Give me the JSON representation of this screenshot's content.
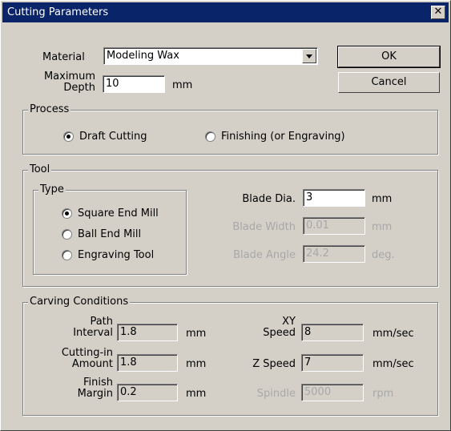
{
  "window": {
    "title": "Cutting Parameters",
    "close_icon": "close-x"
  },
  "material": {
    "label": "Material",
    "value": "Modeling Wax"
  },
  "max_depth": {
    "label_line1": "Maximum",
    "label_line2": "Depth",
    "value": "10",
    "unit": "mm"
  },
  "buttons": {
    "ok": "OK",
    "cancel": "Cancel"
  },
  "process": {
    "legend": "Process",
    "options": [
      {
        "label": "Draft Cutting",
        "selected": true
      },
      {
        "label": "Finishing (or Engraving)",
        "selected": false
      }
    ]
  },
  "tool": {
    "legend": "Tool",
    "type_legend": "Type",
    "types": [
      {
        "label": "Square End Mill",
        "selected": true
      },
      {
        "label": "Ball End Mill",
        "selected": false
      },
      {
        "label": "Engraving Tool",
        "selected": false
      }
    ],
    "blade_dia": {
      "label": "Blade Dia.",
      "value": "3",
      "unit": "mm"
    },
    "blade_width": {
      "label": "Blade Width",
      "value": "0.01",
      "unit": "mm"
    },
    "blade_angle": {
      "label": "Blade Angle",
      "value": "24.2",
      "unit": "deg."
    }
  },
  "carving": {
    "legend": "Carving Conditions",
    "path_interval": {
      "label_line1": "Path",
      "label_line2": "Interval",
      "value": "1.8",
      "unit": "mm"
    },
    "cutting_in": {
      "label_line1": "Cutting-in",
      "label_line2": "Amount",
      "value": "1.8",
      "unit": "mm"
    },
    "finish_margin": {
      "label_line1": "Finish",
      "label_line2": "Margin",
      "value": "0.2",
      "unit": "mm"
    },
    "xy_speed": {
      "label_line1": "XY",
      "label_line2": "Speed",
      "value": "8",
      "unit": "mm/sec"
    },
    "z_speed": {
      "label": "Z Speed",
      "value": "7",
      "unit": "mm/sec"
    },
    "spindle": {
      "label": "Spindle",
      "value": "5000",
      "unit": "rpm"
    }
  }
}
